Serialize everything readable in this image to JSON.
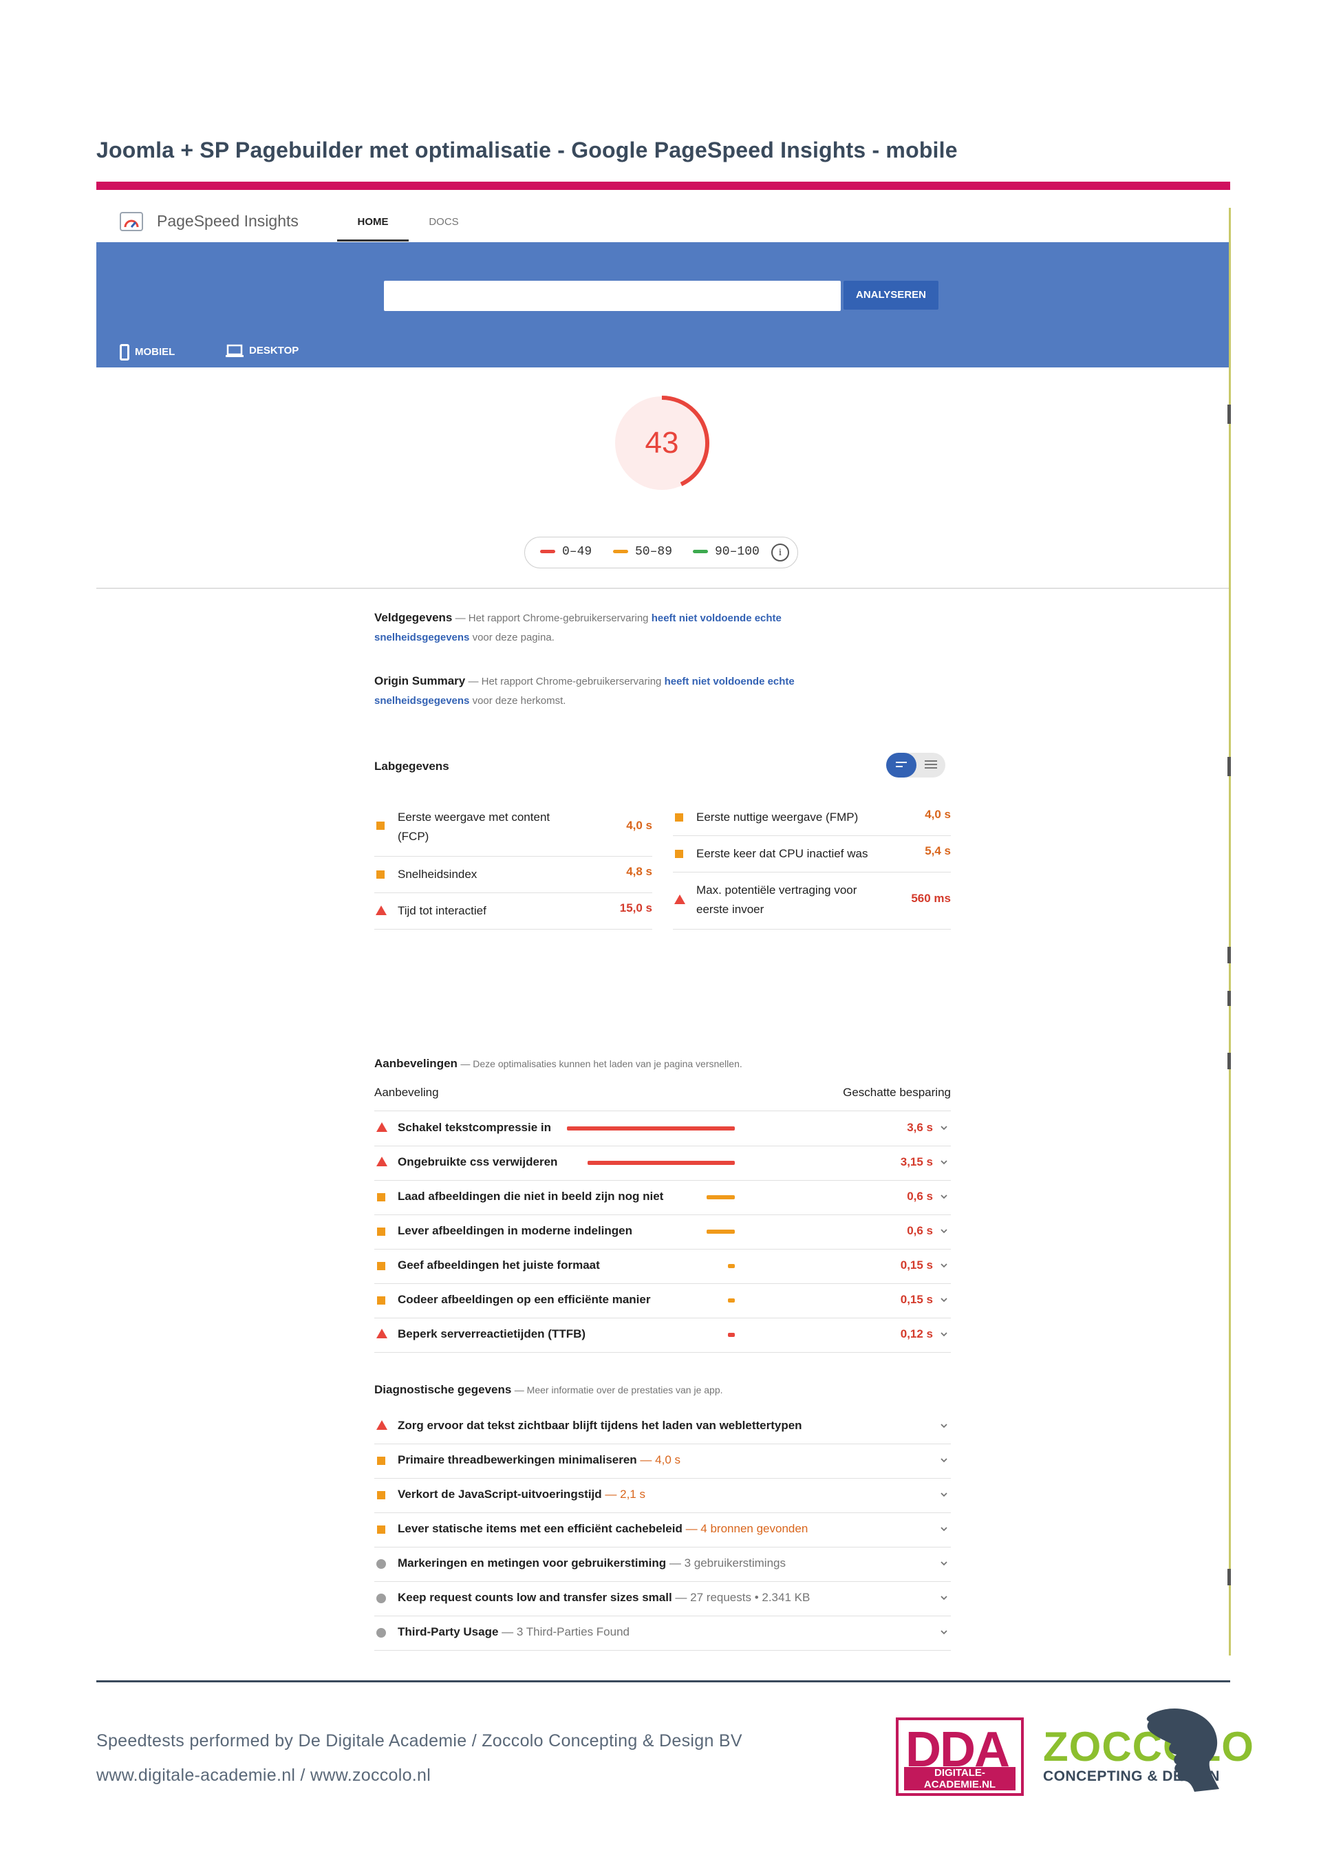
{
  "doc": {
    "title": "Joomla + SP Pagebuilder met optimalisatie - Google PageSpeed Insights - mobile"
  },
  "psi": {
    "logo_text": "PageSpeed Insights",
    "nav": {
      "home": "HOME",
      "docs": "DOCS"
    },
    "url_value": "",
    "analyze_button": "ANALYSEREN",
    "device_tabs": {
      "mobile": "MOBIEL",
      "desktop": "DESKTOP"
    },
    "score": 43,
    "score_color": "#e8453c",
    "legend": [
      {
        "label": "0–49",
        "color": "#e8453c"
      },
      {
        "label": "50–89",
        "color": "#f09a1a"
      },
      {
        "label": "90–100",
        "color": "#3daa4f"
      }
    ],
    "field": {
      "title": "Veldgegevens",
      "desc_pre": "— Het rapport Chrome-gebruikerservaring ",
      "link_a": "heeft niet voldoende echte",
      "link_b": "snelheidsgegevens",
      "desc_post": " voor deze pagina."
    },
    "origin": {
      "title": "Origin Summary",
      "desc_pre": "— Het rapport Chrome-gebruikerservaring ",
      "link_a": "heeft niet voldoende echte",
      "link_b": "snelheidsgegevens",
      "desc_post": " voor deze herkomst."
    },
    "lab": {
      "title": "Labgegevens",
      "left": [
        {
          "label_1": "Eerste weergave met content",
          "label_2": "(FCP)",
          "value": "4,0 s",
          "status": "average"
        },
        {
          "label_1": "Snelheidsindex",
          "label_2": "",
          "value": "4,8 s",
          "status": "average"
        },
        {
          "label_1": "Tijd tot interactief",
          "label_2": "",
          "value": "15,0 s",
          "status": "fail"
        }
      ],
      "right": [
        {
          "label_1": "Eerste nuttige weergave (FMP)",
          "label_2": "",
          "value": "4,0 s",
          "status": "average"
        },
        {
          "label_1": "Eerste keer dat CPU inactief was",
          "label_2": "",
          "value": "5,4 s",
          "status": "average"
        },
        {
          "label_1": "Max. potentiële vertraging voor",
          "label_2": "eerste invoer",
          "value": "560 ms",
          "status": "fail"
        }
      ]
    },
    "opportunities": {
      "title": "Aanbevelingen",
      "desc": "— Deze optimalisaties kunnen het laden van je pagina versnellen.",
      "col_left": "Aanbeveling",
      "col_right": "Geschatte besparing",
      "items": [
        {
          "label": "Schakel tekstcompressie in",
          "value": "3,6 s",
          "savings_s": 3.6,
          "status": "fail"
        },
        {
          "label": "Ongebruikte css verwijderen",
          "value": "3,15 s",
          "savings_s": 3.15,
          "status": "fail"
        },
        {
          "label": "Laad afbeeldingen die niet in beeld zijn nog niet",
          "value": "0,6 s",
          "savings_s": 0.6,
          "status": "average"
        },
        {
          "label": "Lever afbeeldingen in moderne indelingen",
          "value": "0,6 s",
          "savings_s": 0.6,
          "status": "average"
        },
        {
          "label": "Geef afbeeldingen het juiste formaat",
          "value": "0,15 s",
          "savings_s": 0.15,
          "status": "average"
        },
        {
          "label": "Codeer afbeeldingen op een efficiënte manier",
          "value": "0,15 s",
          "savings_s": 0.15,
          "status": "average"
        },
        {
          "label": "Beperk serverreactietijden (TTFB)",
          "value": "0,12 s",
          "savings_s": 0.12,
          "status": "fail"
        }
      ]
    },
    "diagnostics": {
      "title": "Diagnostische gegevens",
      "desc": "— Meer informatie over de prestaties van je app.",
      "items": [
        {
          "label": "Zorg ervoor dat tekst zichtbaar blijft tijdens het laden van weblettertypen",
          "extra": "",
          "status": "fail"
        },
        {
          "label": "Primaire threadbewerkingen minimaliseren",
          "extra": "— 4,0 s",
          "status": "average"
        },
        {
          "label": "Verkort de JavaScript-uitvoeringstijd",
          "extra": "— 2,1 s",
          "status": "average"
        },
        {
          "label": "Lever statische items met een efficiënt cachebeleid",
          "extra": "— 4 bronnen gevonden",
          "status": "average"
        },
        {
          "label": "Markeringen en metingen voor gebruikerstiming",
          "extra": "— 3 gebruikerstimings",
          "status": "info"
        },
        {
          "label": "Keep request counts low and transfer sizes small",
          "extra": "— 27 requests • 2.341 KB",
          "status": "info"
        },
        {
          "label": "Third-Party Usage",
          "extra": "— 3 Third-Parties Found",
          "status": "info"
        }
      ]
    }
  },
  "footer": {
    "line1": "Speedtests performed by De Digitale Academie / Zoccolo Concepting & Design BV",
    "line2": "www.digitale-academie.nl / www.zoccolo.nl",
    "dda_big": "DDA",
    "dda_small": "DIGITALE-ACADEMIE.NL",
    "zoccolo_word": "ZOCCOLO",
    "zoccolo_sub": "CONCEPTING & DESIGN"
  }
}
